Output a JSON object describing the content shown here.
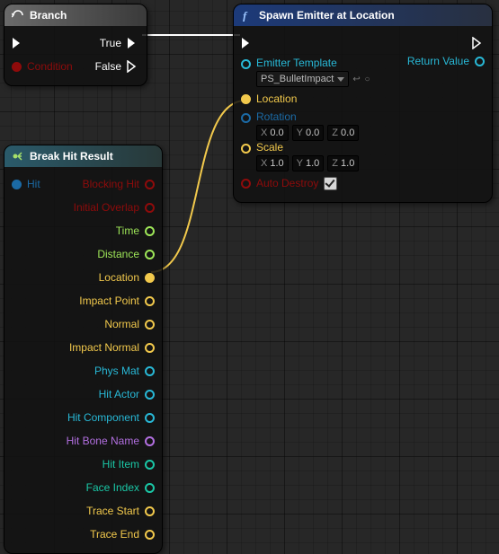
{
  "nodes": {
    "branch": {
      "title": "Branch",
      "inputs": {
        "condition": "Condition"
      },
      "outputs": {
        "true": "True",
        "false": "False"
      }
    },
    "break": {
      "title": "Break Hit Result",
      "inputs": {
        "hit": "Hit"
      },
      "outputs": {
        "blockingHit": "Blocking Hit",
        "initialOverlap": "Initial Overlap",
        "time": "Time",
        "distance": "Distance",
        "location": "Location",
        "impactPoint": "Impact Point",
        "normal": "Normal",
        "impactNormal": "Impact Normal",
        "physMat": "Phys Mat",
        "hitActor": "Hit Actor",
        "hitComponent": "Hit Component",
        "hitBoneName": "Hit Bone Name",
        "hitItem": "Hit Item",
        "faceIndex": "Face Index",
        "traceStart": "Trace Start",
        "traceEnd": "Trace End"
      }
    },
    "spawn": {
      "title": "Spawn Emitter at Location",
      "emitterTemplate": {
        "label": "Emitter Template",
        "value": "PS_BulletImpact"
      },
      "location": {
        "label": "Location"
      },
      "rotation": {
        "label": "Rotation",
        "x": "0.0",
        "y": "0.0",
        "z": "0.0"
      },
      "scale": {
        "label": "Scale",
        "x": "1.0",
        "y": "1.0",
        "z": "1.0"
      },
      "autoDestroy": {
        "label": "Auto Destroy",
        "checked": true
      },
      "returnValue": "Return Value",
      "axis": {
        "x": "X",
        "y": "Y",
        "z": "Z"
      }
    }
  }
}
